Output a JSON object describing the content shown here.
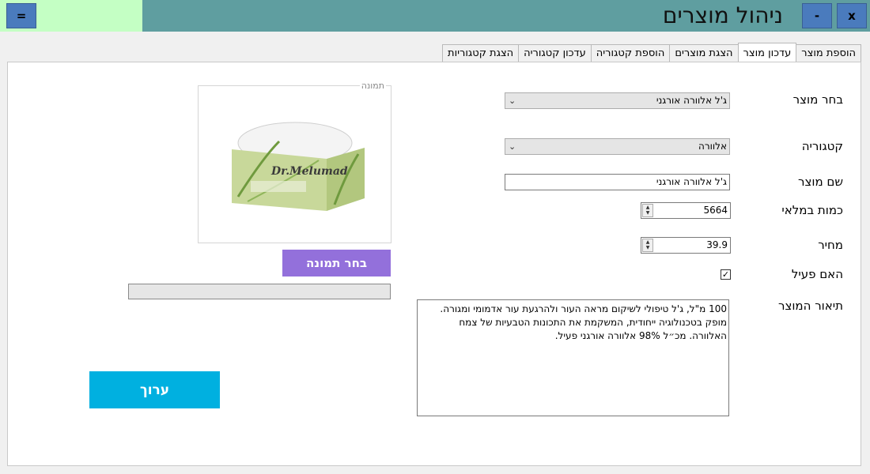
{
  "window": {
    "title": "ניהול מוצרים",
    "menu_button": "=",
    "minimize_button": "-",
    "close_button": "x"
  },
  "tabs": [
    "הוספת מוצר",
    "עדכון מוצר",
    "הצגת מוצרים",
    "הוספת קטגוריה",
    "עדכון קטגוריה",
    "הצגת קטגוריות"
  ],
  "active_tab": "עדכון מוצר",
  "form": {
    "select_product_label": "בחר מוצר",
    "select_product_value": "ג'ל אלוורה אורגני",
    "category_label": "קטגוריה",
    "category_value": "אלוורה",
    "product_name_label": "שם מוצר",
    "product_name_value": "ג'ל אלוורה אורגני",
    "stock_label": "כמות במלאי",
    "stock_value": "5664",
    "price_label": "מחיר",
    "price_value": "39.9",
    "active_label": "האם פעיל",
    "active_checked": true,
    "description_label": "תיאור המוצר",
    "description_value": "100 מ\"ל, ג'ל טיפולי לשיקום מראה העור ולהרגעת עור אדמומי ומגורה. מופק בטכנולוגיה ייחודית, המשקמת את התכונות הטבעיות של צמח האלוורה. מכ״ל 98% אלוורה אורגני פעיל."
  },
  "image_group": {
    "legend": "תמונה",
    "choose_image_button": "בחר תמונה",
    "product_brand": "Dr.Melumad"
  },
  "edit_button": "ערוך",
  "colors": {
    "titlebar": "#5f9ea0",
    "titlebar_green": "#c4ffc4",
    "window_buttons": "#4a7bbd",
    "choose_image_button": "#9370db",
    "edit_button": "#00b0e0"
  }
}
